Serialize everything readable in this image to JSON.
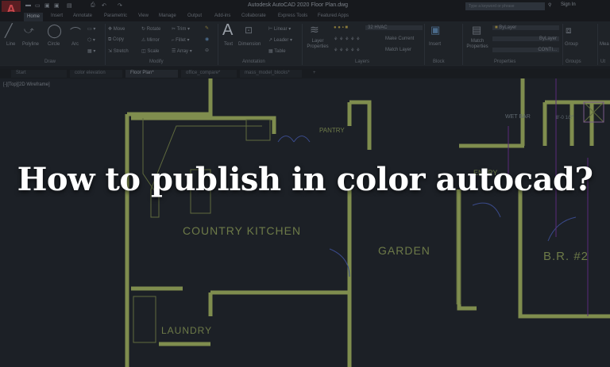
{
  "app": {
    "logo": "A",
    "title": "Autodesk AutoCAD 2020   Floor Plan.dwg",
    "search_placeholder": "Type a keyword or phrase",
    "sign_in": "Sign In"
  },
  "menu_tabs": [
    "Home",
    "Insert",
    "Annotate",
    "Parametric",
    "View",
    "Manage",
    "Output",
    "Add-ins",
    "Collaborate",
    "Express Tools",
    "Featured Apps"
  ],
  "ribbon": {
    "draw": {
      "label": "Draw",
      "items": [
        "Line",
        "Polyline",
        "Circle",
        "Arc"
      ]
    },
    "modify": {
      "label": "Modify",
      "items": [
        "Move",
        "Rotate",
        "Trim",
        "Copy",
        "Mirror",
        "Fillet",
        "Stretch",
        "Scale",
        "Array"
      ]
    },
    "annotation": {
      "label": "Annotation",
      "items": [
        "Text",
        "Dimension",
        "Linear",
        "Leader",
        "Table"
      ]
    },
    "layers": {
      "label": "Layers",
      "layer_properties": "Layer Properties",
      "current_layer": "32 HVAC",
      "make_current": "Make Current",
      "match_layer": "Match Layer"
    },
    "block": {
      "label": "Block",
      "insert": "Insert"
    },
    "properties": {
      "label": "Properties",
      "match": "Match Properties",
      "color": "ByLayer",
      "linetype": "ByLayer",
      "lineweight": "CONTI..."
    },
    "groups": {
      "label": "Groups",
      "group": "Group"
    },
    "utilities": {
      "label": "Ut",
      "measure": "Mea"
    }
  },
  "doc_tabs": [
    "Start",
    "color elevation",
    "Floor Plan*",
    "office_compare*",
    "mass_model_blocks*"
  ],
  "viewport_label": "[-][Top][2D Wireframe]",
  "rooms": [
    "COUNTRY KITCHEN",
    "GARDEN",
    "LAUNDRY",
    "PANTRY",
    "ENTRY",
    "WET BAR",
    "B.R. #2",
    "8'-0 1/2\""
  ],
  "headline": "How to publish in color autocad?",
  "colors": {
    "wall": "#7f8d4e",
    "door": "#3a4a8a",
    "hvac": "#5a2a7a",
    "background": "#1c2026"
  }
}
